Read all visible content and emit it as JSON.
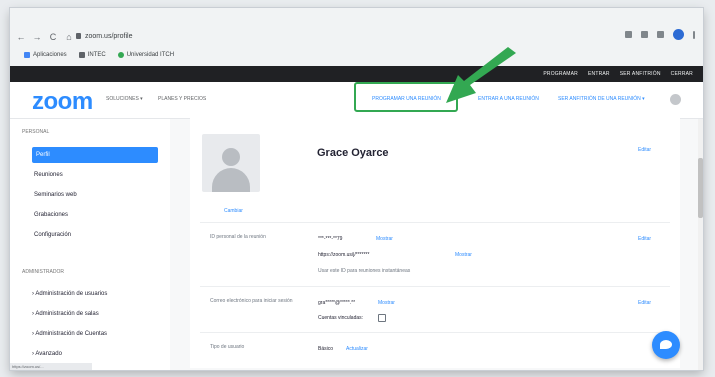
{
  "browser": {
    "nav_back": "←",
    "nav_forward": "→",
    "nav_reload": "C",
    "nav_home": "⌂",
    "url": "zoom.us/profile",
    "bookmarks": [
      {
        "label": "Aplicaciones",
        "color": "#4285f4"
      },
      {
        "label": "INTEC",
        "color": "#5f6368"
      },
      {
        "label": "Universidad ITCH",
        "color": "#34a853"
      }
    ],
    "status_url": "https://zoom.us/..."
  },
  "topbar": {
    "links": [
      "PROGRAMAR",
      "ENTRAR",
      "SER ANFITRIÓN",
      "CERRAR"
    ]
  },
  "header": {
    "logo": "zoom",
    "solutions": "SOLUCIONES ▾",
    "plans": "PLANES Y PRECIOS",
    "highlighted_link": "PROGRAMAR UNA REUNIÓN",
    "join_link": "ENTRAR A UNA REUNIÓN",
    "host_link": "SER ANFITRIÓN DE UNA REUNIÓN ▾"
  },
  "sidebar": {
    "personal_title": "PERSONAL",
    "items": [
      "Perfil",
      "Reuniones",
      "Seminarios web",
      "Grabaciones",
      "Configuración"
    ],
    "admin_title": "ADMINISTRADOR",
    "admin_items": [
      "Administración de usuarios",
      "Administración de salas",
      "Administración de Cuentas",
      "Avanzado"
    ]
  },
  "profile": {
    "name": "Grace Oyarce",
    "edit_label": "Editar",
    "change_photo": "Cambiar",
    "meeting_id_label": "ID personal de la reunión",
    "meeting_id_value": "***-***-**79",
    "meeting_id_hint": "Mostrar",
    "personal_link": "https://zoom.us/j/*******",
    "personal_link_action": "Mostrar",
    "use_pmi_note": "Usar este ID para reuniones instantáneas",
    "signin_label": "Correo electrónico para iniciar sesión",
    "signin_value": "gra*****@*****.**",
    "signin_hint": "Mostrar",
    "linked_accounts": "Cuentas vinculadas:",
    "user_type_label": "Tipo de usuario",
    "user_type_value": "Básico",
    "upgrade": "Actualizar"
  },
  "colors": {
    "zoom_blue": "#2d8cff",
    "highlight_green": "#33a852"
  },
  "icons": {
    "arrow": "green-arrow-icon",
    "chat": "chat-bubble-icon"
  }
}
